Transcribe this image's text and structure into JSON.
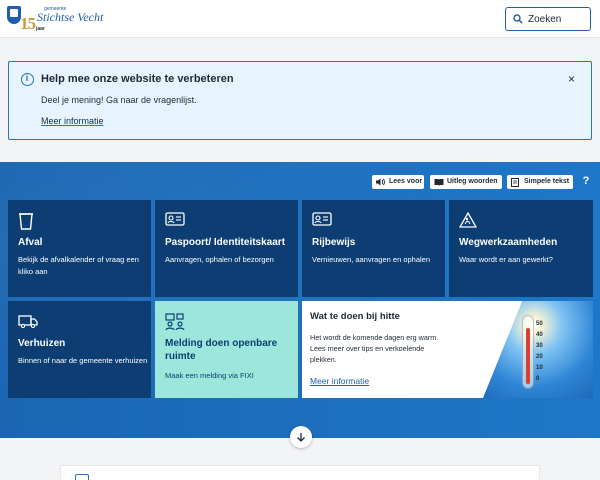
{
  "header": {
    "logo": {
      "small_text": "gemeente",
      "name": "Stichtse Vecht",
      "number": "15",
      "suffix": "jaar"
    },
    "search": {
      "label": "Zoeken",
      "icon": "search-icon"
    }
  },
  "notice": {
    "title": "Help mee onze website te verbeteren",
    "text": "Deel je mening! Ga naar de vragenlijst.",
    "link": "Meer informatie",
    "close_label": "×"
  },
  "toolbar": {
    "read_aloud": "Lees voor",
    "explain_words": "Uitleg woorden",
    "simple_text": "Simpele tekst",
    "help": "?"
  },
  "tiles": [
    {
      "icon": "waste-bin-icon",
      "title": "Afval",
      "desc": "Bekijk de afvalkalender of vraag een kliko aan"
    },
    {
      "icon": "id-card-icon",
      "title": "Paspoort/ Identiteitskaart",
      "desc": "Aanvragen, ophalen of bezorgen"
    },
    {
      "icon": "drivers-license-icon",
      "title": "Rijbewijs",
      "desc": "Vernieuwen, aanvragen en ophalen"
    },
    {
      "icon": "roadwork-sign-icon",
      "title": "Wegwerkzaamheden",
      "desc": "Waar wordt er aan gewerkt?"
    },
    {
      "icon": "moving-truck-icon",
      "title": "Verhuizen",
      "desc": "Binnen of naar de gemeente verhuizen"
    },
    {
      "icon": "public-space-report-icon",
      "title": "Melding doen openbare ruimte",
      "desc": "Maak een melding via FIXI"
    }
  ],
  "heat": {
    "title": "Wat te doen bij hitte",
    "desc": "Het wordt de komende dagen erg warm. Lees meer over tips en verkoelende plekken.",
    "link": "Meer informatie",
    "scale": [
      "50",
      "40",
      "30",
      "20",
      "10",
      "0"
    ]
  },
  "scroll_down": {
    "icon": "arrow-down-icon"
  },
  "colors": {
    "primary": "#1f5ea8",
    "tile": "#0c3e73",
    "accent_tile": "#9de6dc",
    "notice_bg": "#e8f4fd",
    "section_bg": "#1a66b2"
  }
}
